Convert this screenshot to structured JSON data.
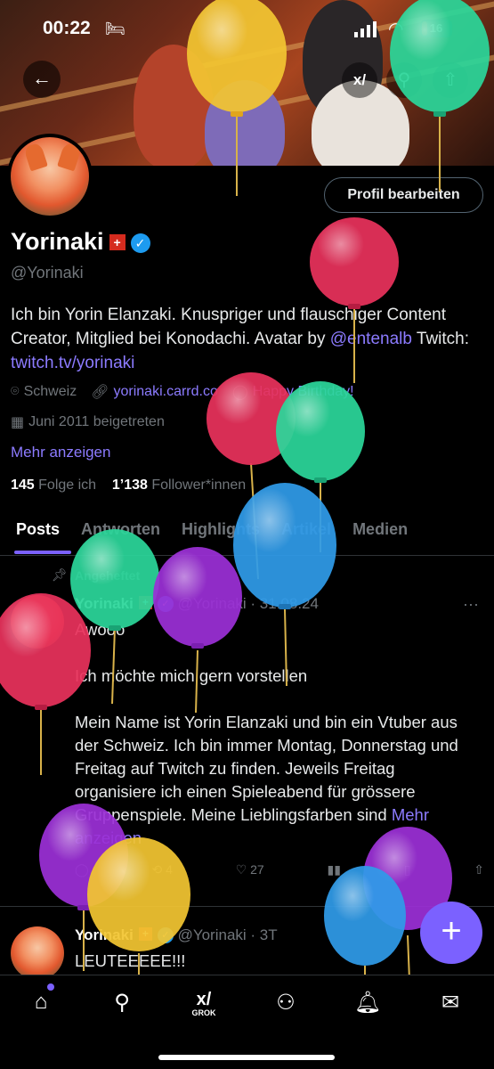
{
  "status_bar": {
    "time": "00:22",
    "battery": "16"
  },
  "header": {
    "grok_label": "GROK"
  },
  "profile": {
    "edit_button": "Profil bearbeiten",
    "display_name": "Yorinaki",
    "flag": "+",
    "handle": "@Yorinaki",
    "bio_text": "Ich bin Yorin Elanzaki. Knuspriger und flauschiger Content Creator, Mitglied bei Konodachi. Avatar by ",
    "bio_mention": "@entenalb",
    "bio_twitch_label": " Twitch: ",
    "bio_twitch_link": "twitch.tv/yorinaki",
    "location": "Schweiz",
    "website": "yorinaki.carrd.co",
    "birthday": "Happy Birthday!",
    "joined": "Juni 2011 beigetreten",
    "show_more": "Mehr anzeigen",
    "following_count": "145",
    "following_label": "Folge ich",
    "followers_count": "1’138",
    "followers_label": "Follower*innen"
  },
  "tabs": [
    "Posts",
    "Antworten",
    "Highlights",
    "Artikel",
    "Medien"
  ],
  "pinned_post": {
    "pinned_label": "Angeheftet",
    "name": "Yorinaki",
    "handle_date": "@Yorinaki · 31.08.24",
    "line1": "Awooo",
    "line2": "Ich möchte mich gern vorstellen",
    "line3": "Mein Name ist Yorin Elanzaki und bin ein Vtuber aus der Schweiz. Ich bin immer Montag, Donnerstag und Freitag auf Twitch zu finden. Jeweils Freitag organisiere ich einen Spieleabend für grössere Gruppenspiele. Meine Lieblingsfarben sind ",
    "show_more": "Mehr anzeigen",
    "retweets": "4",
    "likes": "27"
  },
  "second_post": {
    "name": "Yorinaki",
    "handle_date": "@Yorinaki · 3T",
    "text": "LEUTEEEEE!!!"
  },
  "colors": {
    "accent": "#7b61ff",
    "verified": "#1d9bf0",
    "background": "#000000"
  },
  "nav": [
    "home-icon",
    "search-icon",
    "grok-icon",
    "communities-icon",
    "notifications-icon",
    "messages-icon"
  ]
}
